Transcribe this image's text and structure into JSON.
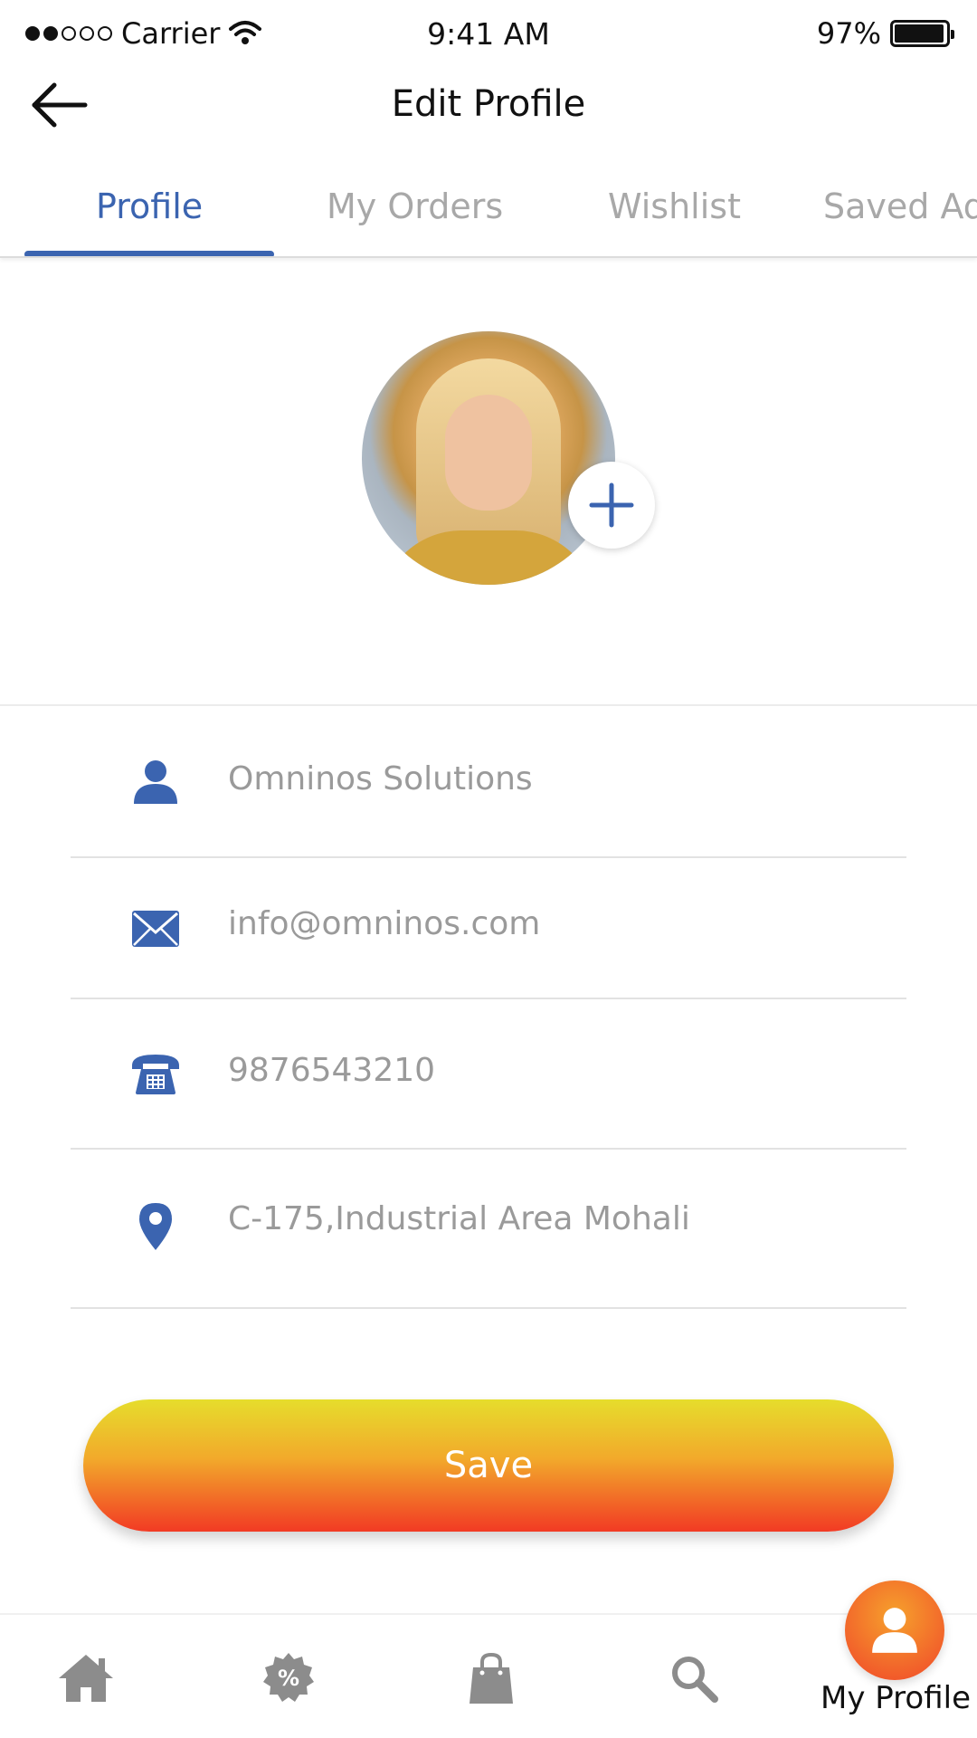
{
  "status_bar": {
    "carrier": "Carrier",
    "time": "9:41 AM",
    "battery": "97%",
    "battery_level": 0.97
  },
  "header": {
    "title": "Edit Profile",
    "back_icon": "arrow-left-icon"
  },
  "tabs": [
    {
      "label": "Profile",
      "active": true
    },
    {
      "label": "My Orders",
      "active": false
    },
    {
      "label": "Wishlist",
      "active": false
    },
    {
      "label": "Saved Ad",
      "active": false
    }
  ],
  "profile": {
    "avatar_icon": "profile-photo",
    "add_photo_icon": "plus-icon"
  },
  "form": {
    "name": {
      "value": "Omninos Solutions",
      "icon": "person-icon"
    },
    "email": {
      "value": "info@omninos.com",
      "icon": "envelope-icon"
    },
    "phone": {
      "value": "9876543210",
      "icon": "telephone-icon"
    },
    "address": {
      "value": "C-175,Industrial Area Mohali",
      "icon": "location-pin-icon"
    }
  },
  "save_button": {
    "label": "Save"
  },
  "bottom_nav": {
    "items": [
      {
        "icon": "home-icon"
      },
      {
        "icon": "offers-icon"
      },
      {
        "icon": "shopping-bag-icon"
      },
      {
        "icon": "search-icon"
      },
      {
        "icon": "profile-icon",
        "label": "My Profile",
        "active": true
      }
    ]
  },
  "colors": {
    "accent": "#3b64b0",
    "inactive_text": "#a8a8a8",
    "input_text": "#9a9a9a",
    "save_gradient_top": "#e6dd2c",
    "save_gradient_bottom": "#f23a24",
    "nav_icon": "#8c8c8c"
  }
}
